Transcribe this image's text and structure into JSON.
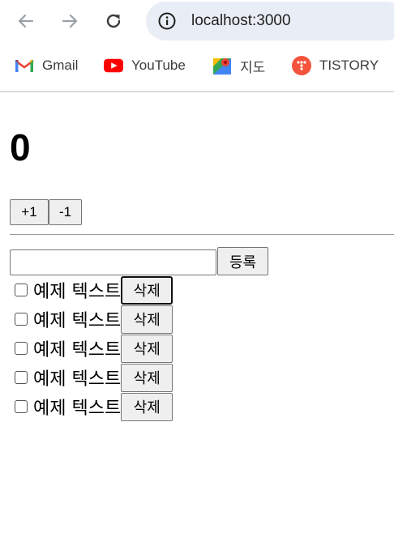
{
  "browser": {
    "url": "localhost:3000",
    "bookmarks": [
      {
        "label": "Gmail",
        "icon": "gmail-icon"
      },
      {
        "label": "YouTube",
        "icon": "youtube-icon"
      },
      {
        "label": "지도",
        "icon": "maps-icon"
      },
      {
        "label": "TISTORY",
        "icon": "tistory-icon"
      }
    ]
  },
  "counter": {
    "value": "0",
    "increment_label": "+1",
    "decrement_label": "-1"
  },
  "todo": {
    "input_value": "",
    "register_label": "등록",
    "items": [
      {
        "text": "예제 텍스트",
        "checked": false,
        "delete_label": "삭제"
      },
      {
        "text": "예제 텍스트",
        "checked": false,
        "delete_label": "삭제"
      },
      {
        "text": "예제 텍스트",
        "checked": false,
        "delete_label": "삭제"
      },
      {
        "text": "예제 텍스트",
        "checked": false,
        "delete_label": "삭제"
      },
      {
        "text": "예제 텍스트",
        "checked": false,
        "delete_label": "삭제"
      }
    ]
  },
  "colors": {
    "omnibox": "#e9eef6",
    "button": "#efefef",
    "youtube": "#ff0000",
    "tistory": "#f4543c"
  }
}
